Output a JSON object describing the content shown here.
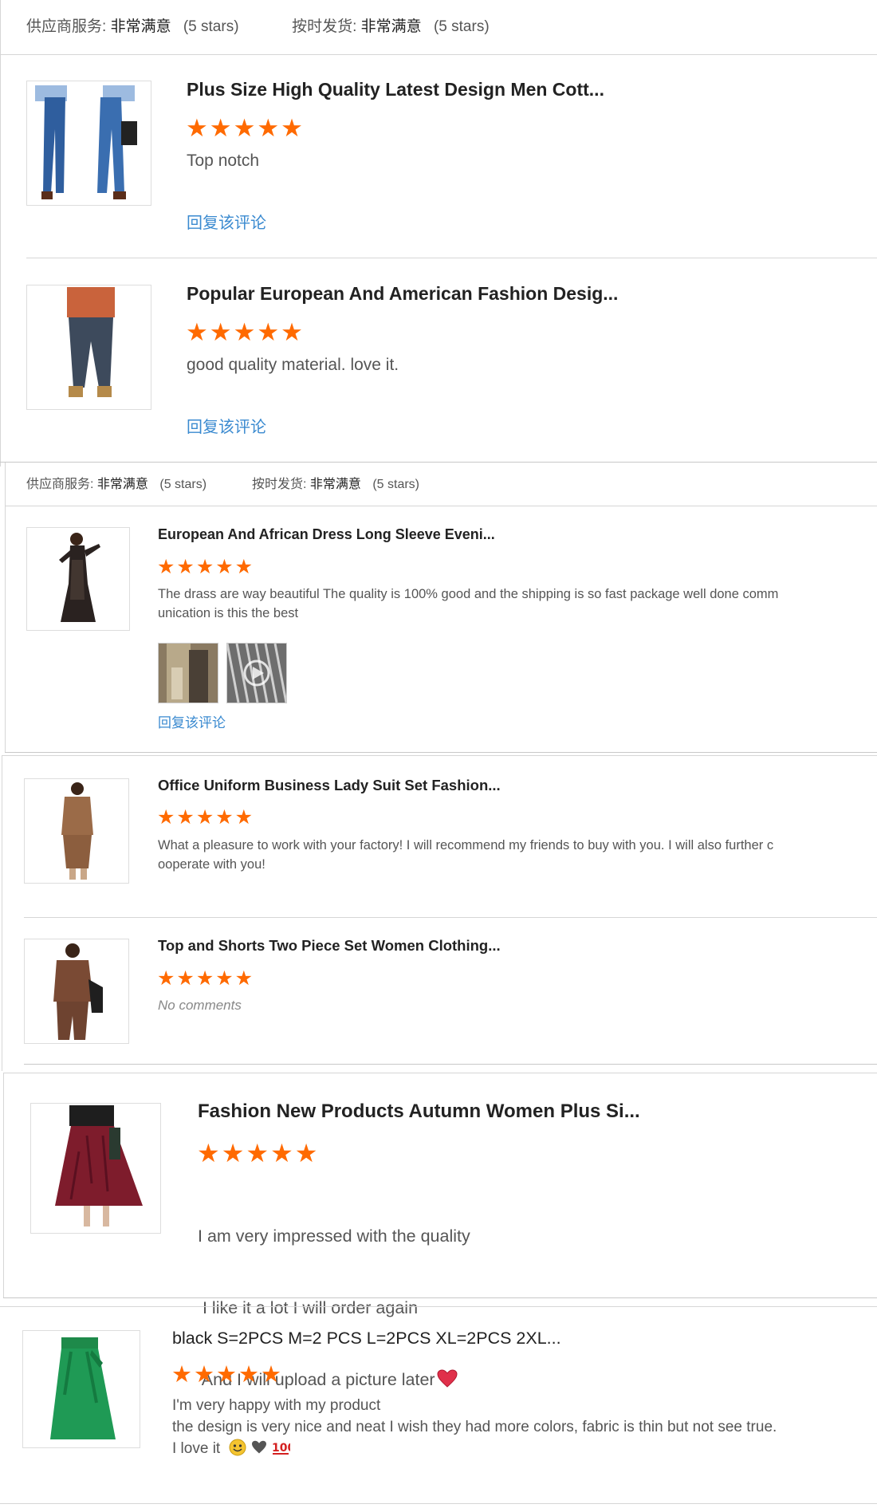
{
  "rating_bars": [
    {
      "service_label": "供应商服务:",
      "service_value": "非常满意",
      "service_stars": "(5 stars)",
      "ship_label": "按时发货:",
      "ship_value": "非常满意",
      "ship_stars": "(5 stars)"
    },
    {
      "service_label": "供应商服务:",
      "service_value": "非常满意",
      "service_stars": "(5 stars)",
      "ship_label": "按时发货:",
      "ship_value": "非常满意",
      "ship_stars": "(5 stars)"
    }
  ],
  "reviews": [
    {
      "title": "Plus Size High Quality Latest Design Men Cott...",
      "stars": "★★★★★",
      "rating": 5,
      "text": [
        "Top notch"
      ],
      "reply": "回复该评论",
      "thumb_icon": "jeans-men-photo"
    },
    {
      "title": "Popular European And American Fashion Desig...",
      "stars": "★★★★★",
      "rating": 5,
      "text": [
        "good quality material. love it."
      ],
      "reply": "回复该评论",
      "thumb_icon": "jeans-man-photo"
    },
    {
      "title": "European And African Dress Long Sleeve Eveni...",
      "stars": "★★★★★",
      "rating": 5,
      "text": [
        "The drass are way beautiful  The quality is 100% good and the shipping is so fast package well done comm",
        "unication is this the best"
      ],
      "reply": "回复该评论",
      "thumb_icon": "evening-dress-photo",
      "photos": [
        "dress-detail-photo",
        "dress-video-thumbnail"
      ]
    },
    {
      "title": "Office Uniform Business Lady Suit Set Fashion...",
      "stars": "★★★★★",
      "rating": 5,
      "text": [
        "What a pleasure to work with your factory! I will recommend my friends to buy with you. I will also further c",
        "ooperate with you!"
      ],
      "thumb_icon": "lady-suit-photo"
    },
    {
      "title": "Top and Shorts Two Piece Set Women Clothing...",
      "stars": "★★★★★",
      "rating": 5,
      "text": [
        "No comments"
      ],
      "thumb_icon": "two-piece-set-photo"
    },
    {
      "title": "Fashion New Products Autumn Women Plus Si...",
      "stars": "★★★★★",
      "rating": 5,
      "text": [
        "I am very impressed with the quality",
        " I like it a lot I will order again",
        " And I will upload a picture later"
      ],
      "emoji": [
        "heart-emoji"
      ],
      "thumb_icon": "maroon-skirt-photo"
    },
    {
      "title": "black S=2PCS M=2 PCS L=2PCS XL=2PCS 2XL...",
      "stars": "★★★★★",
      "rating": 5,
      "text": [
        "I'm very happy with my product",
        "the design is very nice and neat I wish they had more colors, fabric is thin but not see true.",
        "I love it"
      ],
      "emoji": [
        "smiley-emoji",
        "heart-emoji",
        "hundred-emoji"
      ],
      "thumb_icon": "green-skirt-photo"
    }
  ],
  "colors": {
    "star": "#ff6a00",
    "link": "#3a8ad0",
    "divider": "#d6d6d6"
  }
}
